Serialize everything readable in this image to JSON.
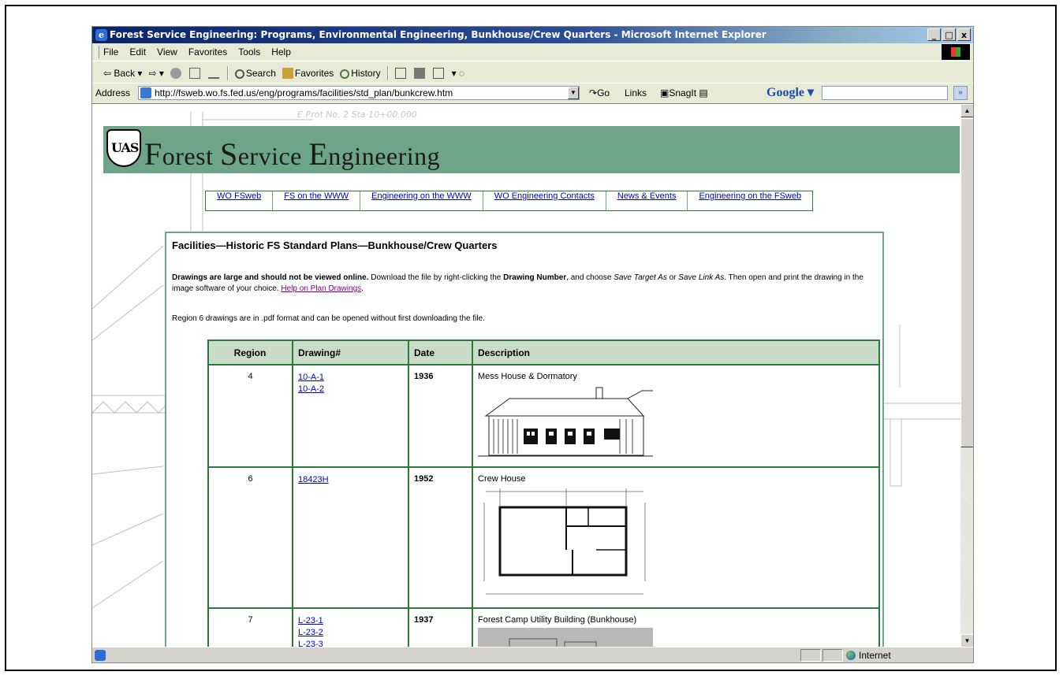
{
  "window": {
    "title": "Forest Service Engineering: Programs, Environmental Engineering, Bunkhouse/Crew Quarters - Microsoft Internet Explorer",
    "controls": [
      "_",
      "□",
      "x"
    ]
  },
  "menu": [
    "File",
    "Edit",
    "View",
    "Favorites",
    "Tools",
    "Help"
  ],
  "toolbar": {
    "back": "Back",
    "search": "Search",
    "favorites": "Favorites",
    "history": "History"
  },
  "address": {
    "label": "Address",
    "url": "http://fsweb.wo.fs.fed.us/eng/programs/facilities/std_plan/bunkcrew.htm",
    "go": "Go",
    "links": "Links",
    "snagit": "SnagIt",
    "google": "Google",
    "google_dd": "▾",
    "more": "»"
  },
  "banner": {
    "logo_text": "UAS",
    "title_f": "F",
    "title_1": "orest ",
    "title_s": "S",
    "title_2": "ervice ",
    "title_e": "E",
    "title_3": "ngineering"
  },
  "nav": [
    "WO FSweb",
    "FS on the WWW",
    "Engineering on the WWW",
    "WO Engineering Contacts",
    "News & Events",
    "Engineering on the FSweb"
  ],
  "page": {
    "heading": "Facilities—Historic FS Standard Plans—Bunkhouse/Crew Quarters",
    "intro_bold": "Drawings are large and should not be viewed online.",
    "intro_1": " Download the file by right-clicking the ",
    "intro_drawing_number": "Drawing Number",
    "intro_2": ", and choose ",
    "intro_save_target": "Save Target As",
    "intro_or": " or ",
    "intro_save_link": "Save Link As",
    "intro_3": ". Then open and print the drawing in the image software of your choice. ",
    "help_link": "Help on Plan Drawings",
    "intro_end": ".",
    "note": "Region 6 drawings are in .pdf format and can be opened without first downloading the file."
  },
  "table": {
    "headers": [
      "Region",
      "Drawing#",
      "Date",
      "Description"
    ],
    "rows": [
      {
        "region": "4",
        "drawings": [
          "10-A-1",
          "10-A-2"
        ],
        "date": "1936",
        "description": "Mess House & Dormatory"
      },
      {
        "region": "6",
        "drawings": [
          "18423H"
        ],
        "date": "1952",
        "description": "Crew House"
      },
      {
        "region": "7",
        "drawings": [
          "L-23-1",
          "L-23-2",
          "L-23-3"
        ],
        "date": "1937",
        "description": "Forest Camp Utility Building (Bunkhouse)"
      }
    ]
  },
  "status": {
    "zone": "Internet"
  }
}
